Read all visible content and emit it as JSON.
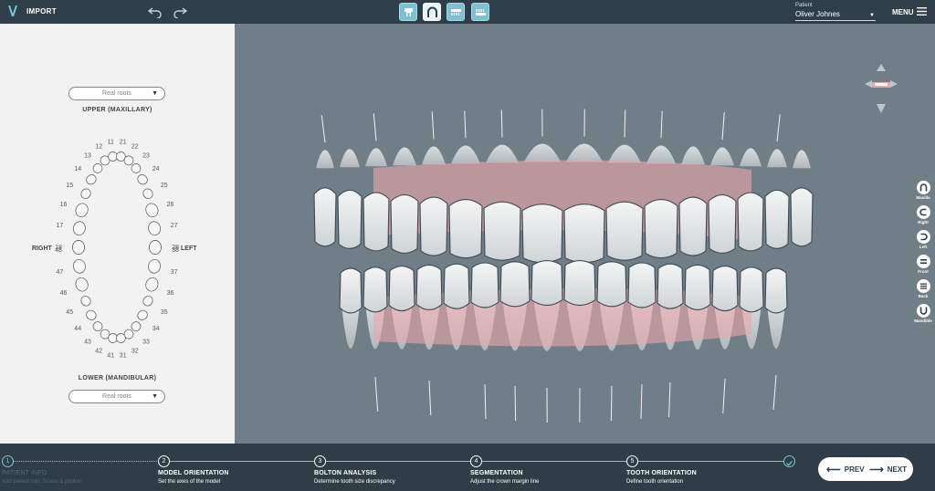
{
  "topbar": {
    "import_label": "IMPORT",
    "patient_caption": "Patient",
    "patient_name": "Oliver Johnes",
    "menu_label": "MENU"
  },
  "left_panel": {
    "upper_select": "Real roots",
    "upper_title": "UPPER (MAXILLARY)",
    "lower_title": "LOWER (MANDIBULAR)",
    "lower_select": "Real roots",
    "right_label": "RIGHT",
    "left_label": "LEFT",
    "upper_teeth": [
      "18",
      "17",
      "16",
      "15",
      "14",
      "13",
      "12",
      "11",
      "21",
      "22",
      "23",
      "24",
      "25",
      "26",
      "27",
      "28"
    ],
    "lower_teeth": [
      "48",
      "47",
      "46",
      "45",
      "44",
      "43",
      "42",
      "41",
      "31",
      "32",
      "33",
      "34",
      "35",
      "36",
      "37",
      "38"
    ]
  },
  "view_buttons": [
    {
      "label": "Maxilla",
      "icon": "maxilla-icon"
    },
    {
      "label": "Right",
      "icon": "right-view-icon"
    },
    {
      "label": "Left",
      "icon": "left-view-icon"
    },
    {
      "label": "Front",
      "icon": "front-view-icon"
    },
    {
      "label": "Back",
      "icon": "back-view-icon"
    },
    {
      "label": "Mandible",
      "icon": "mandible-icon"
    }
  ],
  "steps": [
    {
      "num": "1",
      "title": "PATIENT INFO",
      "desc": "Add patient info, Scans & photos"
    },
    {
      "num": "2",
      "title": "MODEL ORIENTATION",
      "desc": "Set the axes of the model"
    },
    {
      "num": "3",
      "title": "BOLTON ANALYSIS",
      "desc": "Determine tooth size discrepancy"
    },
    {
      "num": "4",
      "title": "SEGMENTATION",
      "desc": "Adjust the crown margin line"
    },
    {
      "num": "5",
      "title": "TOOTH ORIENTATION",
      "desc": "Define tooth orientation"
    }
  ],
  "nav": {
    "prev": "PREV",
    "next": "NEXT"
  },
  "colors": {
    "accent": "#7bc7d6",
    "topbar": "#2f3f49",
    "viewport": "#707f87",
    "gum": "#e9a7ab"
  }
}
